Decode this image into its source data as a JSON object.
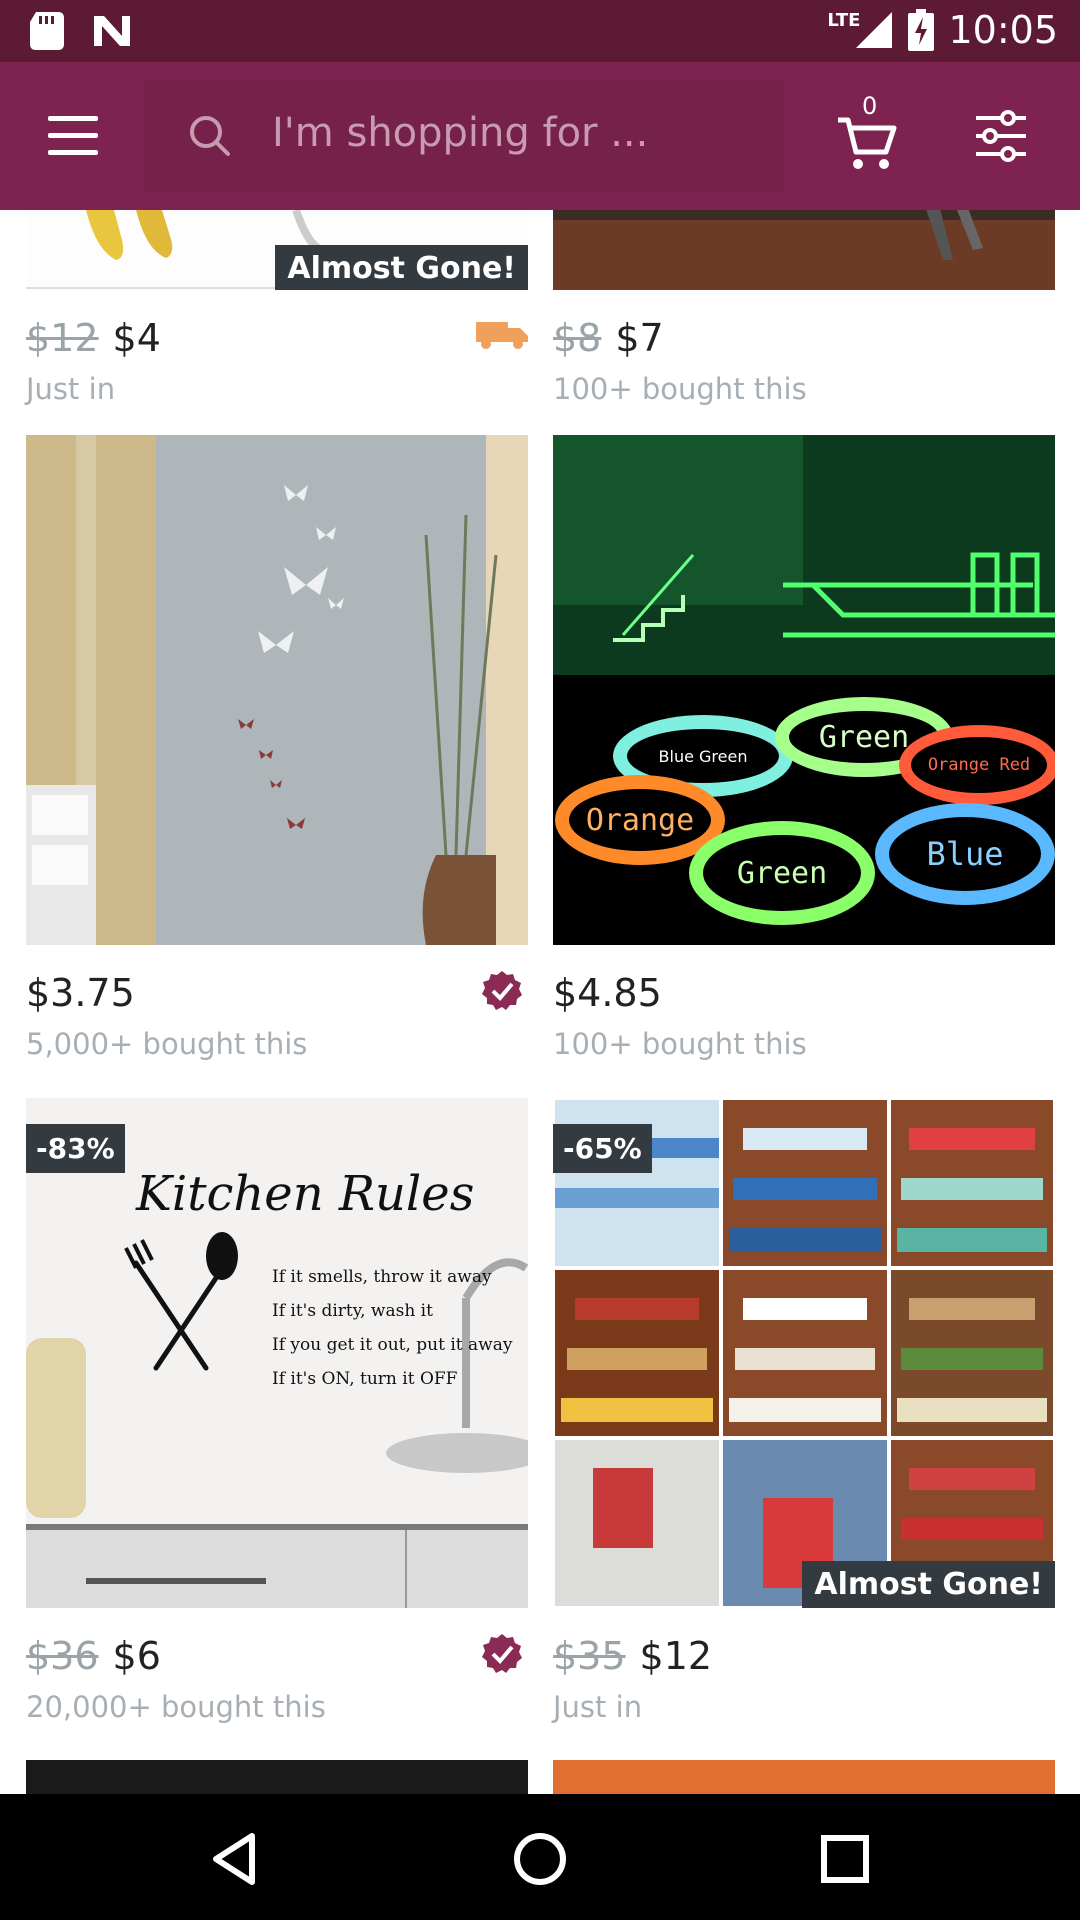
{
  "status_bar": {
    "time": "10:05",
    "network": "LTE",
    "icons": [
      "sd-card-icon",
      "n-icon",
      "signal-icon",
      "battery-charging-icon"
    ]
  },
  "app_bar": {
    "search_placeholder": "I'm shopping for ...",
    "cart_count": "0",
    "icons": [
      "hamburger-menu-icon",
      "search-icon",
      "cart-icon",
      "filter-sliders-icon"
    ]
  },
  "products": [
    {
      "id": "p1",
      "original_price": "$12",
      "price": "$4",
      "meta": "Just in",
      "badge": "Almost Gone!",
      "shipping_icon": "truck-icon",
      "verified": false
    },
    {
      "id": "p2",
      "original_price": "$8",
      "price": "$7",
      "meta": "100+ bought this",
      "badge": "",
      "verified": false
    },
    {
      "id": "p3",
      "original_price": "",
      "price": "$3.75",
      "meta": "5,000+ bought this",
      "verified": true
    },
    {
      "id": "p4",
      "original_price": "",
      "price": "$4.85",
      "meta": "100+ bought this",
      "image_text": {
        "blue_green": "Blue Green",
        "green_top": "Green",
        "orange_red": "Orange Red",
        "orange": "Orange",
        "blue": "Blue",
        "green_bottom": "Green"
      },
      "verified": false
    },
    {
      "id": "p5",
      "discount": "-83%",
      "original_price": "$36",
      "price": "$6",
      "meta": "20,000+ bought this",
      "image_text": {
        "title": "Kitchen Rules",
        "line1": "If it smells, throw it away",
        "line2": "If it's dirty, wash it",
        "line3": "If you get it out, put it away",
        "line4": "If it's ON, turn it OFF"
      },
      "verified": true
    },
    {
      "id": "p6",
      "discount": "-65%",
      "original_price": "$35",
      "price": "$12",
      "meta": "Just in",
      "badge": "Almost Gone!",
      "verified": false
    }
  ],
  "colors": {
    "status_bar": "#5d1a35",
    "app_bar": "#7e2350",
    "search_field": "#75214a",
    "verified_badge": "#8b2a55",
    "shipping_truck": "#f0a05a",
    "badge_bg": "#343b40"
  },
  "nav_bar": {
    "icons": [
      "back-triangle-icon",
      "home-circle-icon",
      "recents-square-icon"
    ]
  }
}
